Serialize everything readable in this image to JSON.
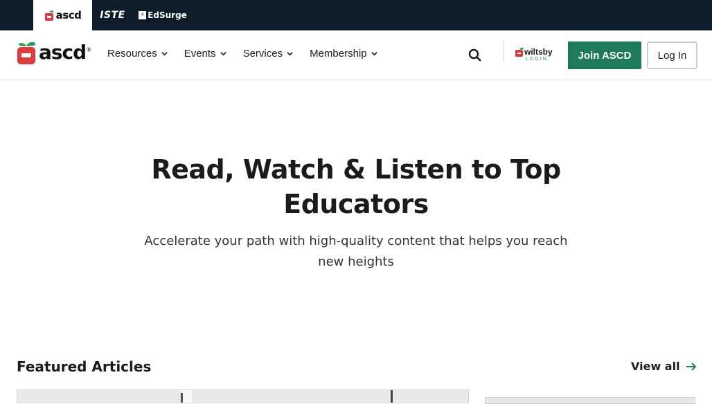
{
  "brands": {
    "ascd": "ascd",
    "iste": "ISTE",
    "edsurge": "EdSurge"
  },
  "logo": {
    "text": "ascd",
    "mark": "®"
  },
  "nav": {
    "items": [
      {
        "label": "Resources",
        "icon": "chevron-down-icon"
      },
      {
        "label": "Events",
        "icon": "chevron-down-icon"
      },
      {
        "label": "Services",
        "icon": "chevron-down-icon"
      },
      {
        "label": "Membership",
        "icon": "chevron-down-icon"
      }
    ],
    "search_icon": "search-icon",
    "wiltsby": {
      "name": "wiltsby",
      "login": "LOGIN"
    },
    "join_label": "Join ASCD",
    "login_label": "Log In"
  },
  "hero": {
    "title": "Read, Watch & Listen to Top Educators",
    "subtitle": "Accelerate your path with high-quality content that helps you reach new heights"
  },
  "featured": {
    "title": "Featured Articles",
    "view_all": "View all"
  },
  "colors": {
    "brand_bar": "#0d1b2a",
    "accent_green": "#1f7a5c",
    "logo_red": "#e03a3e",
    "logo_green": "#2e9a57"
  }
}
